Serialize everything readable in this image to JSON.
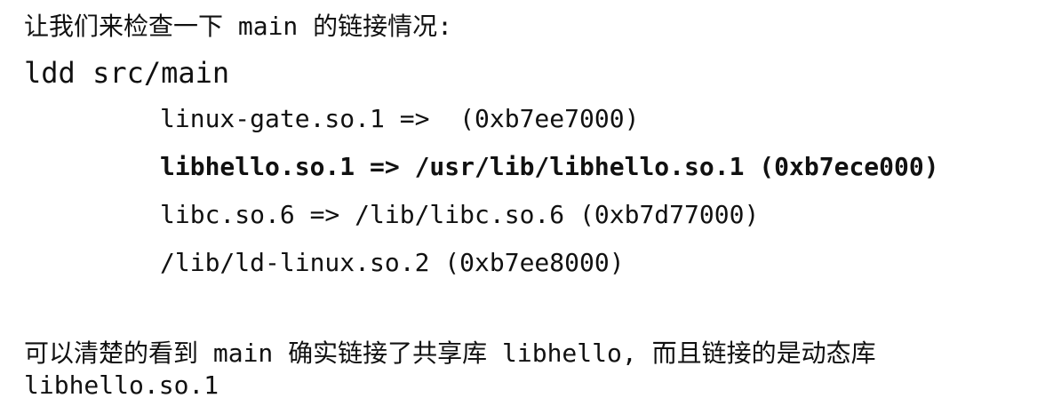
{
  "intro": "让我们来检查一下 main 的链接情况:",
  "command": "ldd src/main",
  "output": [
    "linux-gate.so.1 =>  (0xb7ee7000)",
    "libhello.so.1 => /usr/lib/libhello.so.1 (0xb7ece000)",
    "libc.so.6 => /lib/libc.so.6 (0xb7d77000)",
    "/lib/ld-linux.so.2 (0xb7ee8000)"
  ],
  "outro": {
    "line1": "可以清楚的看到 main 确实链接了共享库 libhello, 而且链接的是动态库",
    "line2": "libhello.so.1"
  }
}
